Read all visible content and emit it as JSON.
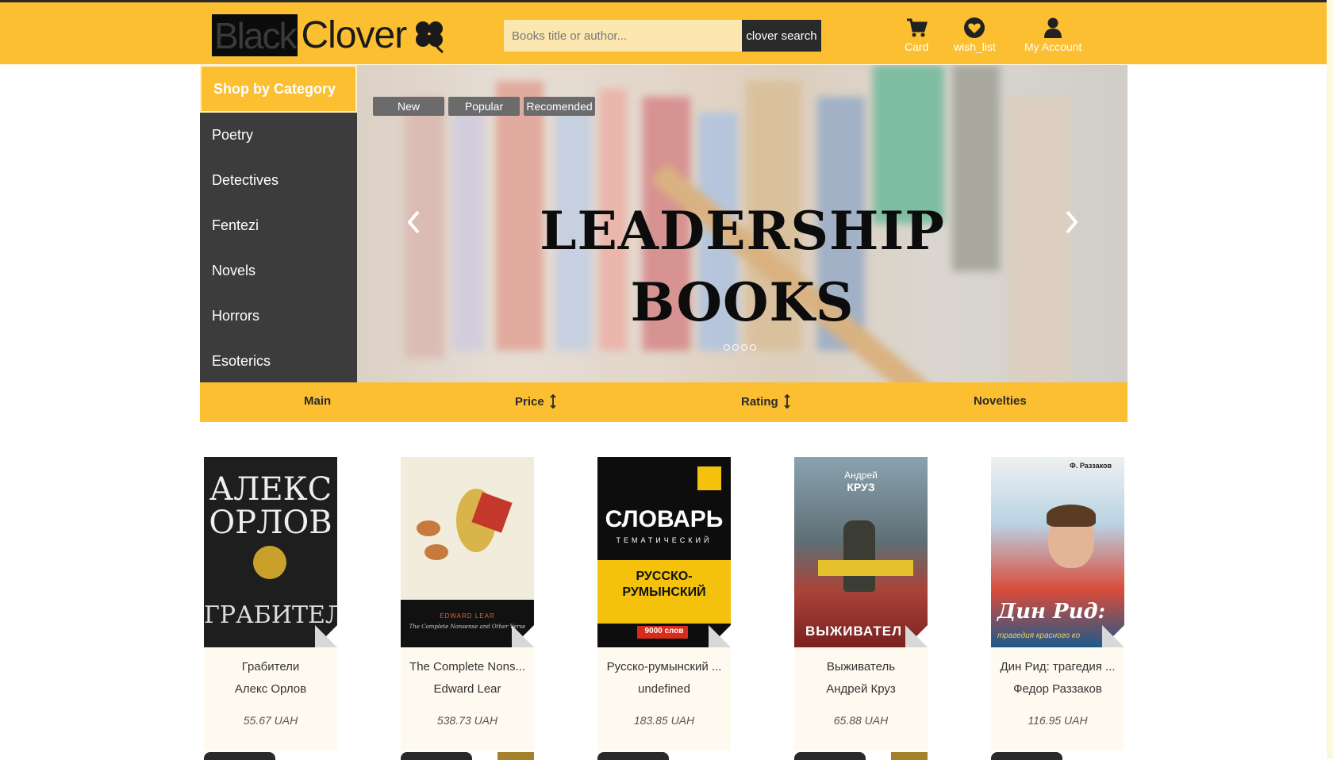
{
  "header": {
    "logo_black": "Black",
    "logo_clover": "Clover",
    "search_placeholder": "Books title or author...",
    "search_button": "clover search",
    "nav": {
      "cart": "Card",
      "wishlist": "wish_list",
      "account": "My Account"
    }
  },
  "sidebar": {
    "title": "Shop by Category",
    "items": [
      "Poetry",
      "Detectives",
      "Fentezi",
      "Novels",
      "Horrors",
      "Esoterics"
    ]
  },
  "carousel": {
    "tabs": [
      "New",
      "Popular",
      "Recomended"
    ],
    "line1": "LEADERSHIP",
    "line2": "BOOKS",
    "prev_icon": "chevron-left-icon",
    "next_icon": "chevron-right-icon"
  },
  "sortbar": {
    "main": "Main",
    "price": "Price",
    "rating": "Rating",
    "novelties": "Novelties"
  },
  "products": [
    {
      "title": "Грабители",
      "author": "Алекс Орлов",
      "price": "55.67 UAH",
      "cover_text": [
        "АЛЕКС",
        "ОРЛОВ",
        "ГРАБИТЕЛИ"
      ]
    },
    {
      "title": "The Complete Nons...",
      "author": "Edward Lear",
      "price": "538.73 UAH",
      "cover_text": [
        "EDWARD LEAR",
        "The Complete Nonsense and Other Verse"
      ]
    },
    {
      "title": "Русско-румынский ...",
      "author": "undefined",
      "price": "183.85 UAH",
      "cover_text": [
        "СЛОВАРЬ",
        "ТЕМАТИЧЕСКИЙ",
        "РУССКО-",
        "РУМЫНСКИЙ",
        "9000 слов"
      ]
    },
    {
      "title": "Выживатель",
      "author": "Андрей Круз",
      "price": "65.88 UAH",
      "cover_text": [
        "Андрей",
        "КРУЗ",
        "ВЫЖИВАТЕЛ"
      ]
    },
    {
      "title": "Дин Рид: трагедия ...",
      "author": "Федор Раззаков",
      "price": "116.95 UAH",
      "cover_text": [
        "Ф. Раззаков",
        "Дин Рид:",
        "трагедия красного ко"
      ]
    }
  ],
  "colors": {
    "accent": "#fbbf31",
    "dark": "#3c3c3c"
  }
}
